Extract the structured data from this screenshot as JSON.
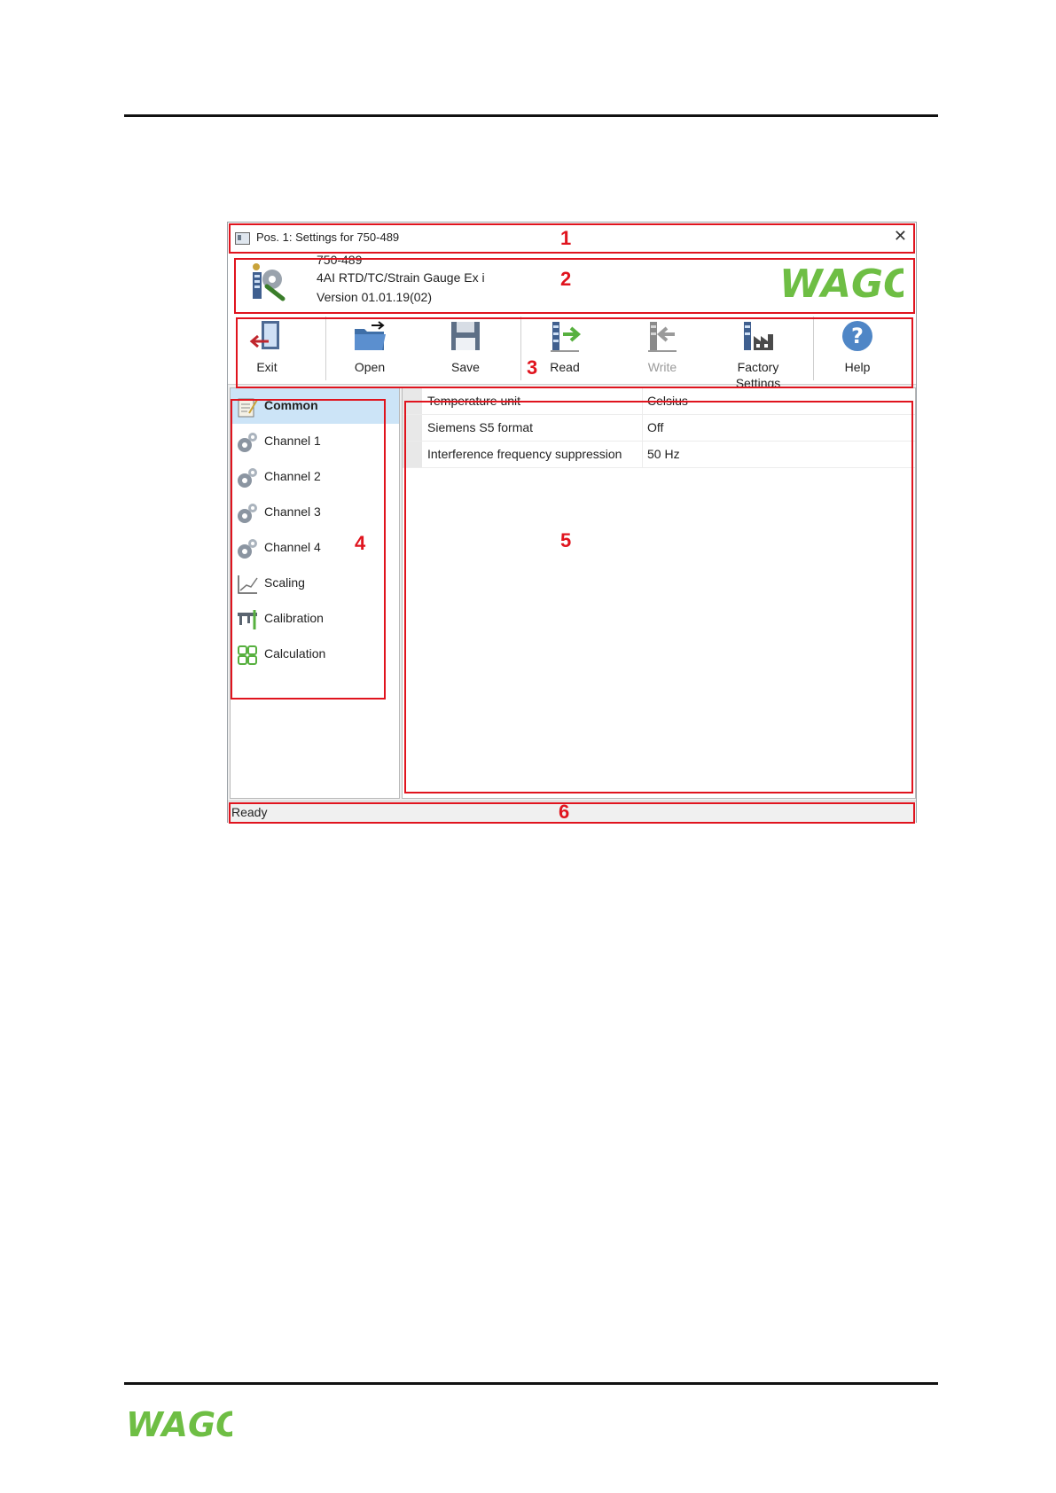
{
  "window": {
    "title": "Pos. 1: Settings for 750-489",
    "close_glyph": "✕"
  },
  "device": {
    "part_number": "750-489",
    "description": "4AI RTD/TC/Strain Gauge Ex i",
    "version": "Version 01.01.19(02)",
    "logo_text": "WAGO"
  },
  "toolbar": {
    "items": [
      {
        "label": "Exit",
        "icon": "exit-icon"
      },
      {
        "label": "Open",
        "icon": "folder-open-icon"
      },
      {
        "label": "Save",
        "icon": "floppy-save-icon"
      },
      {
        "label": "Read",
        "icon": "read-icon"
      },
      {
        "label": "Write",
        "icon": "write-icon",
        "disabled": true
      },
      {
        "label": "Factory",
        "label2": "Settings",
        "icon": "factory-icon"
      },
      {
        "label": "Help",
        "icon": "help-icon"
      }
    ]
  },
  "sidebar": {
    "items": [
      {
        "label": "Common",
        "icon": "notepad-icon",
        "active": true
      },
      {
        "label": "Channel 1",
        "icon": "gears-icon"
      },
      {
        "label": "Channel 2",
        "icon": "gears-icon"
      },
      {
        "label": "Channel 3",
        "icon": "gears-icon"
      },
      {
        "label": "Channel 4",
        "icon": "gears-icon"
      },
      {
        "label": "Scaling",
        "icon": "chart-line-icon"
      },
      {
        "label": "Calibration",
        "icon": "caliper-icon"
      },
      {
        "label": "Calculation",
        "icon": "calculator-icon"
      }
    ]
  },
  "properties": [
    {
      "name": "Temperature unit",
      "value": "Celsius"
    },
    {
      "name": "Siemens S5 format",
      "value": "Off"
    },
    {
      "name": "Interference frequency suppression",
      "value": "50 Hz"
    }
  ],
  "status": {
    "text": "Ready"
  },
  "callouts": [
    "1",
    "2",
    "3",
    "4",
    "5",
    "6"
  ],
  "footer": {
    "logo_text": "WAGO"
  },
  "colors": {
    "callout_red": "#e0141e",
    "wago_green": "#6ebe44",
    "selection_blue": "#cce4f7"
  }
}
